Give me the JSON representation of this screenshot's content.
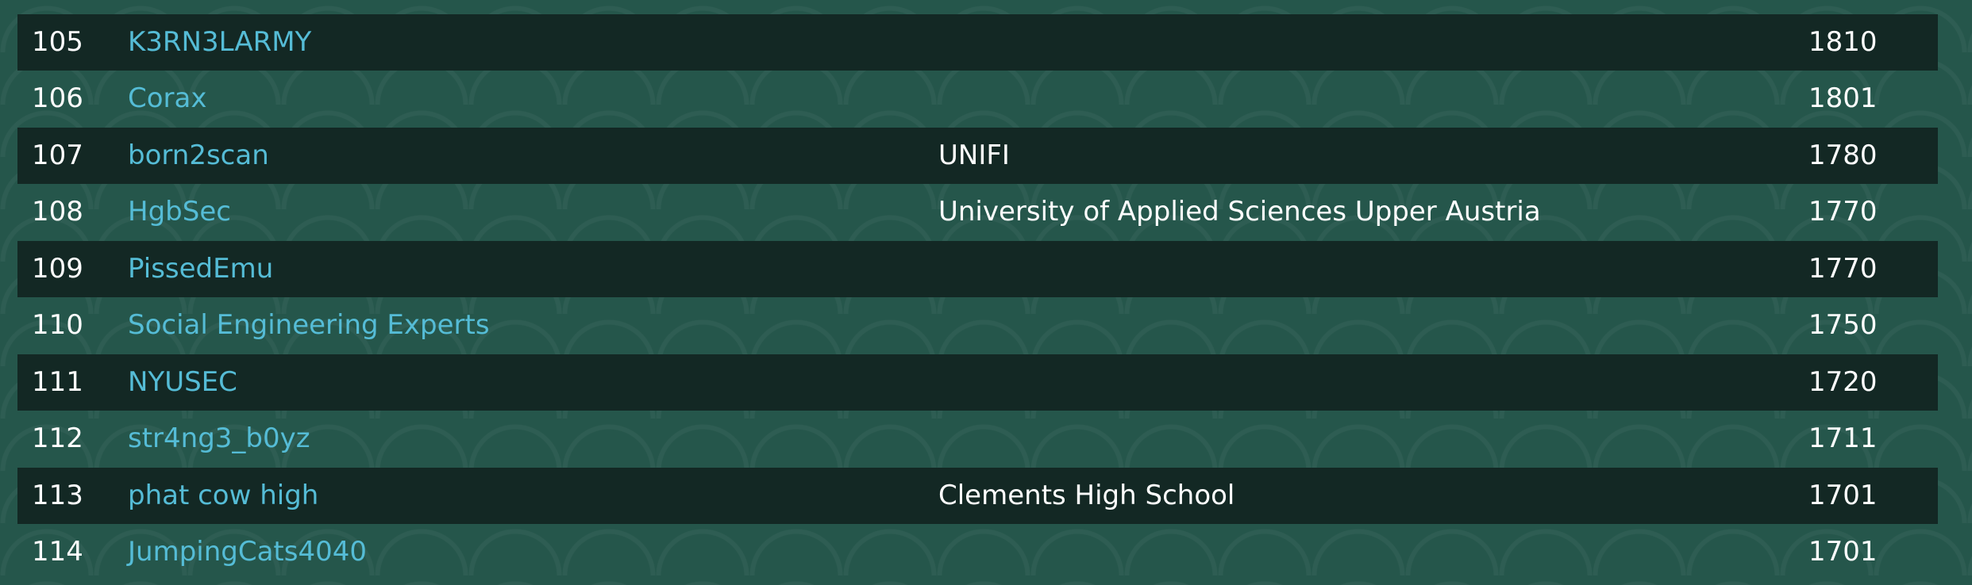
{
  "scoreboard": {
    "rows": [
      {
        "rank": "105",
        "team": "K3RN3LARMY",
        "affiliation": "",
        "score": "1810"
      },
      {
        "rank": "106",
        "team": "Corax",
        "affiliation": "",
        "score": "1801"
      },
      {
        "rank": "107",
        "team": "born2scan",
        "affiliation": "UNIFI",
        "score": "1780"
      },
      {
        "rank": "108",
        "team": "HgbSec",
        "affiliation": "University of Applied Sciences Upper Austria",
        "score": "1770"
      },
      {
        "rank": "109",
        "team": "PissedEmu",
        "affiliation": "",
        "score": "1770"
      },
      {
        "rank": "110",
        "team": "Social Engineering Experts",
        "affiliation": "",
        "score": "1750"
      },
      {
        "rank": "111",
        "team": "NYUSEC",
        "affiliation": "",
        "score": "1720"
      },
      {
        "rank": "112",
        "team": "str4ng3_b0yz",
        "affiliation": "",
        "score": "1711"
      },
      {
        "rank": "113",
        "team": "phat cow high",
        "affiliation": "Clements High School",
        "score": "1701"
      },
      {
        "rank": "114",
        "team": "JumpingCats4040",
        "affiliation": "",
        "score": "1701"
      }
    ]
  }
}
